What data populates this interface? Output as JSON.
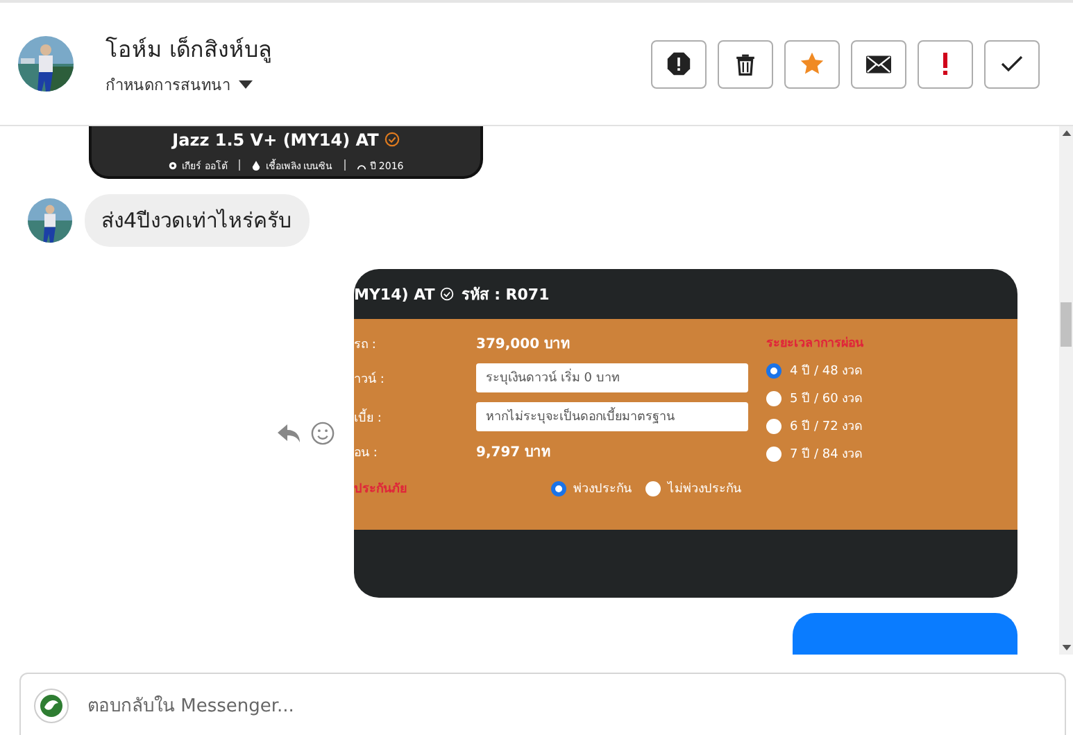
{
  "header": {
    "name": "โอห์ม เด็กสิงห์บลู",
    "subtitle": "กำหนดการสนทนา",
    "actions": [
      {
        "kind": "spam"
      },
      {
        "kind": "delete"
      },
      {
        "kind": "star"
      },
      {
        "kind": "unread"
      },
      {
        "kind": "important"
      },
      {
        "kind": "done"
      }
    ]
  },
  "messages": [
    {
      "kind": "card",
      "title": "Jazz 1.5 V+ (MY14) AT",
      "meta": [
        "เกียร์ ออโต้",
        "เชื้อเพลิง เบนซิน",
        "ปี 2016"
      ]
    },
    {
      "kind": "incoming",
      "text": "ส่ง4ปีงวดเท่าไหร่ครับ"
    },
    {
      "kind": "calculator",
      "title": "MY14) AT",
      "code": "รหัส : R071",
      "rows": [
        {
          "label": "รถ :",
          "kind": "value",
          "value": "379,000 บาท"
        },
        {
          "label": "าวน์ :",
          "kind": "input",
          "placeholder": "ระบุเงินดาวน์ เริ่ม 0 บาท"
        },
        {
          "label": "เบี้ย :",
          "kind": "input",
          "placeholder": "หากไม่ระบุจะเป็นดอกเบี้ยมาตรฐาน"
        },
        {
          "label": "อน :",
          "kind": "value",
          "value": "9,797 บาท"
        }
      ],
      "insurance_label": "ประกันภัย",
      "insurance": [
        {
          "label": "พ่วงประกัน",
          "selected": true
        },
        {
          "label": "ไม่พ่วงประกัน",
          "selected": false
        }
      ],
      "term_heading": "ระยะเวลาการผ่อน",
      "terms": [
        {
          "label": "4 ปี / 48 งวด",
          "selected": true
        },
        {
          "label": "5 ปี / 60 งวด",
          "selected": false
        },
        {
          "label": "6 ปี / 72 งวด",
          "selected": false
        },
        {
          "label": "7 ปี / 84 งวด",
          "selected": false
        }
      ]
    },
    {
      "kind": "outgoing"
    }
  ],
  "composer": {
    "placeholder": "ตอบกลับใน Messenger..."
  }
}
